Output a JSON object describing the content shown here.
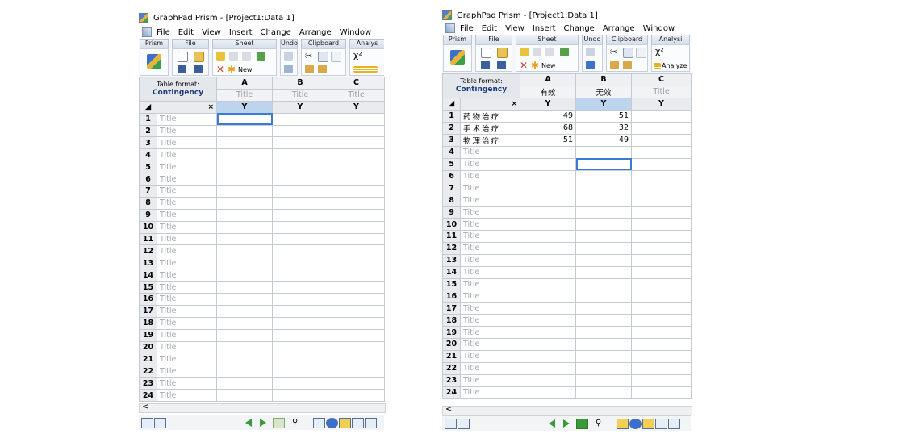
{
  "left": {
    "title": "GraphPad Prism - [Project1:Data 1]",
    "menu": [
      "File",
      "Edit",
      "View",
      "Insert",
      "Change",
      "Arrange",
      "Window"
    ],
    "ribbon_groups": [
      "Prism",
      "File",
      "Sheet",
      "Undo",
      "Clipboard",
      "Analys"
    ],
    "ribbon_new": "New",
    "ribbon_chi": "χ²",
    "table_format_label": "Table format:",
    "table_format_value": "Contingency",
    "columns": [
      {
        "letter": "A",
        "sub": "Title",
        "y": "Y"
      },
      {
        "letter": "B",
        "sub": "Title",
        "y": "Y"
      },
      {
        "letter": "C",
        "sub": "Title",
        "y": "Y"
      }
    ],
    "corner_x": "×",
    "rows": [
      {
        "n": "1",
        "title": "Title"
      },
      {
        "n": "2",
        "title": "Title"
      },
      {
        "n": "3",
        "title": "Title"
      },
      {
        "n": "4",
        "title": "Title"
      },
      {
        "n": "5",
        "title": "Title"
      },
      {
        "n": "6",
        "title": "Title"
      },
      {
        "n": "7",
        "title": "Title"
      },
      {
        "n": "8",
        "title": "Title"
      },
      {
        "n": "9",
        "title": "Title"
      },
      {
        "n": "10",
        "title": "Title"
      },
      {
        "n": "11",
        "title": "Title"
      },
      {
        "n": "12",
        "title": "Title"
      },
      {
        "n": "13",
        "title": "Title"
      },
      {
        "n": "14",
        "title": "Title"
      },
      {
        "n": "15",
        "title": "Title"
      },
      {
        "n": "16",
        "title": "Title"
      },
      {
        "n": "17",
        "title": "Title"
      },
      {
        "n": "18",
        "title": "Title"
      },
      {
        "n": "19",
        "title": "Title"
      },
      {
        "n": "20",
        "title": "Title"
      },
      {
        "n": "21",
        "title": "Title"
      },
      {
        "n": "22",
        "title": "Title"
      },
      {
        "n": "23",
        "title": "Title"
      },
      {
        "n": "24",
        "title": "Title"
      }
    ],
    "scroll_arrow": "<"
  },
  "right": {
    "title": "GraphPad Prism - [Project1:Data 1]",
    "menu": [
      "File",
      "Edit",
      "View",
      "Insert",
      "Change",
      "Arrange",
      "Window"
    ],
    "ribbon_groups": [
      "Prism",
      "File",
      "Sheet",
      "Undo",
      "Clipboard",
      "Analysi"
    ],
    "ribbon_new": "New",
    "ribbon_chi": "χ²",
    "ribbon_analyze": "Analyze",
    "table_format_label": "Table format:",
    "table_format_value": "Contingency",
    "columns": [
      {
        "letter": "A",
        "sub": "有效",
        "y": "Y"
      },
      {
        "letter": "B",
        "sub": "无效",
        "y": "Y"
      },
      {
        "letter": "C",
        "sub": "Title",
        "y": "Y"
      }
    ],
    "corner_x": "×",
    "rows": [
      {
        "n": "1",
        "title": "药物治疗",
        "a": "49",
        "b": "51"
      },
      {
        "n": "2",
        "title": "手术治疗",
        "a": "68",
        "b": "32"
      },
      {
        "n": "3",
        "title": "物理治疗",
        "a": "51",
        "b": "49"
      },
      {
        "n": "4",
        "title": "Title"
      },
      {
        "n": "5",
        "title": "Title"
      },
      {
        "n": "6",
        "title": "Title"
      },
      {
        "n": "7",
        "title": "Title"
      },
      {
        "n": "8",
        "title": "Title"
      },
      {
        "n": "9",
        "title": "Title"
      },
      {
        "n": "10",
        "title": "Title"
      },
      {
        "n": "11",
        "title": "Title"
      },
      {
        "n": "12",
        "title": "Title"
      },
      {
        "n": "13",
        "title": "Title"
      },
      {
        "n": "14",
        "title": "Title"
      },
      {
        "n": "15",
        "title": "Title"
      },
      {
        "n": "16",
        "title": "Title"
      },
      {
        "n": "17",
        "title": "Title"
      },
      {
        "n": "18",
        "title": "Title"
      },
      {
        "n": "19",
        "title": "Title"
      },
      {
        "n": "20",
        "title": "Title"
      },
      {
        "n": "21",
        "title": "Title"
      },
      {
        "n": "22",
        "title": "Title"
      },
      {
        "n": "23",
        "title": "Title"
      },
      {
        "n": "24",
        "title": "Title"
      }
    ],
    "scroll_arrow": "<"
  },
  "colors": {
    "selected_header": "#bcd4ee",
    "selection_outline": "#3a7bd5",
    "contingency_text": "#1f3c7a",
    "placeholder_text": "#a5aab2"
  }
}
